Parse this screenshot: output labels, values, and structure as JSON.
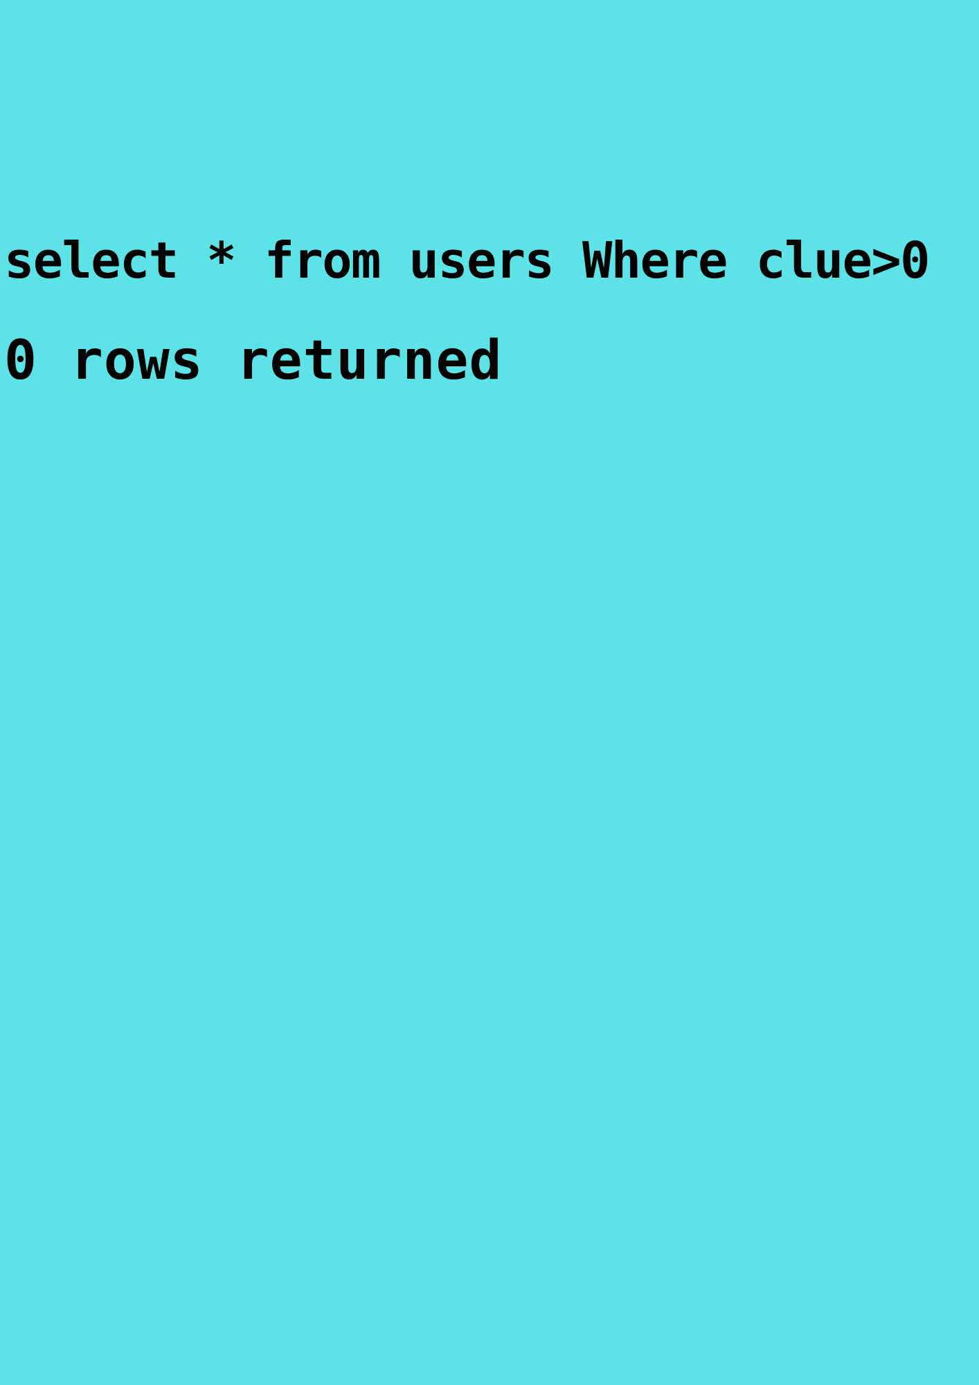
{
  "query": {
    "text": "select * from users Where clue>0"
  },
  "result": {
    "text": "0 rows returned"
  },
  "colors": {
    "background": "#5DE2E6",
    "text": "#000000"
  }
}
